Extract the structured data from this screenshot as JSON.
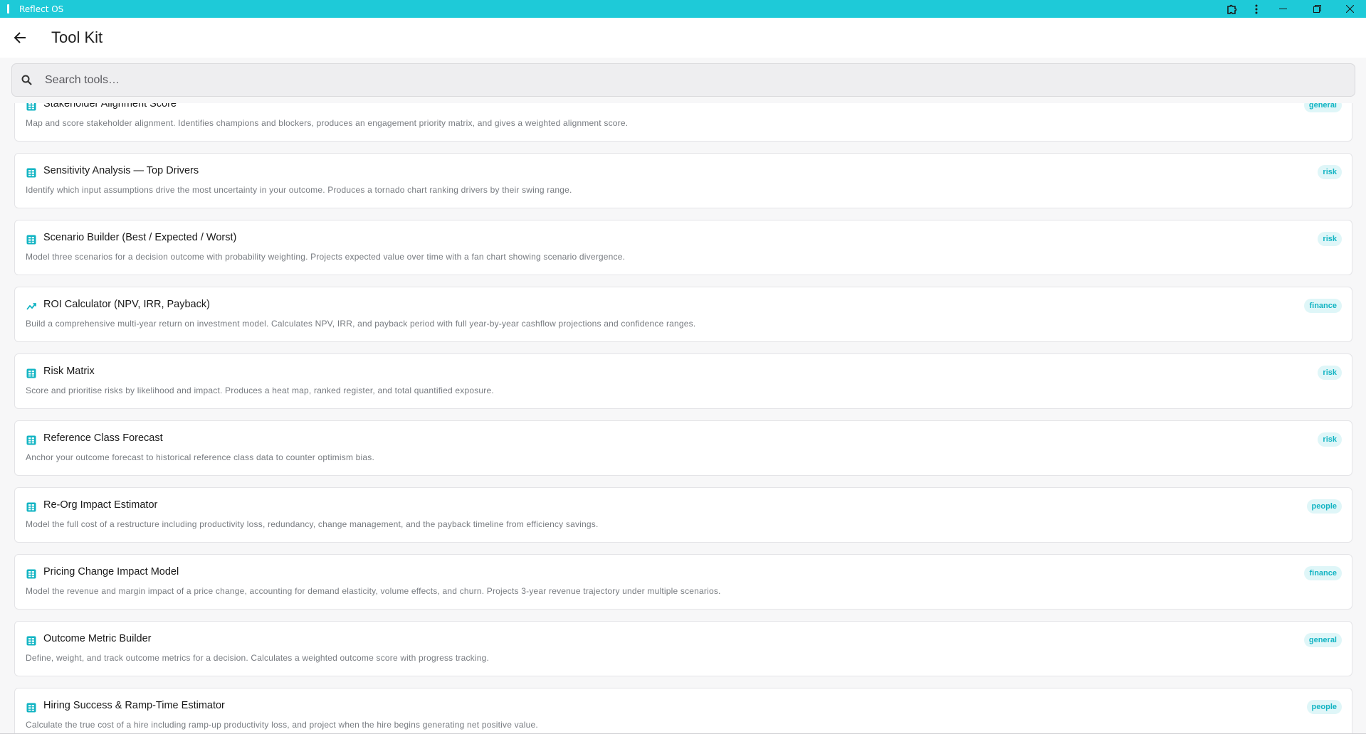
{
  "window": {
    "title": "Reflect OS"
  },
  "header": {
    "title": "Tool Kit"
  },
  "search": {
    "placeholder": "Search tools…"
  },
  "colors": {
    "titlebar": "#1ecad8",
    "accent": "#12b4c3",
    "tag_bg": "#dff6f8"
  },
  "tools": [
    {
      "name": "Stakeholder Alignment Score",
      "description": "Map and score stakeholder alignment. Identifies champions and blockers, produces an engagement priority matrix, and gives a weighted alignment score.",
      "tag": "general",
      "icon": "table-icon"
    },
    {
      "name": "Sensitivity Analysis — Top Drivers",
      "description": "Identify which input assumptions drive the most uncertainty in your outcome. Produces a tornado chart ranking drivers by their swing range.",
      "tag": "risk",
      "icon": "table-icon"
    },
    {
      "name": "Scenario Builder (Best / Expected / Worst)",
      "description": "Model three scenarios for a decision outcome with probability weighting. Projects expected value over time with a fan chart showing scenario divergence.",
      "tag": "risk",
      "icon": "table-icon"
    },
    {
      "name": "ROI Calculator (NPV, IRR, Payback)",
      "description": "Build a comprehensive multi-year return on investment model. Calculates NPV, IRR, and payback period with full year-by-year cashflow projections and confidence ranges.",
      "tag": "finance",
      "icon": "trending-up-icon"
    },
    {
      "name": "Risk Matrix",
      "description": "Score and prioritise risks by likelihood and impact. Produces a heat map, ranked register, and total quantified exposure.",
      "tag": "risk",
      "icon": "table-icon"
    },
    {
      "name": "Reference Class Forecast",
      "description": "Anchor your outcome forecast to historical reference class data to counter optimism bias.",
      "tag": "risk",
      "icon": "table-icon"
    },
    {
      "name": "Re-Org Impact Estimator",
      "description": "Model the full cost of a restructure including productivity loss, redundancy, change management, and the payback timeline from efficiency savings.",
      "tag": "people",
      "icon": "table-icon"
    },
    {
      "name": "Pricing Change Impact Model",
      "description": "Model the revenue and margin impact of a price change, accounting for demand elasticity, volume effects, and churn. Projects 3-year revenue trajectory under multiple scenarios.",
      "tag": "finance",
      "icon": "table-icon"
    },
    {
      "name": "Outcome Metric Builder",
      "description": "Define, weight, and track outcome metrics for a decision. Calculates a weighted outcome score with progress tracking.",
      "tag": "general",
      "icon": "table-icon"
    },
    {
      "name": "Hiring Success & Ramp-Time Estimator",
      "description": "Calculate the true cost of a hire including ramp-up productivity loss, and project when the hire begins generating net positive value.",
      "tag": "people",
      "icon": "table-icon"
    }
  ]
}
